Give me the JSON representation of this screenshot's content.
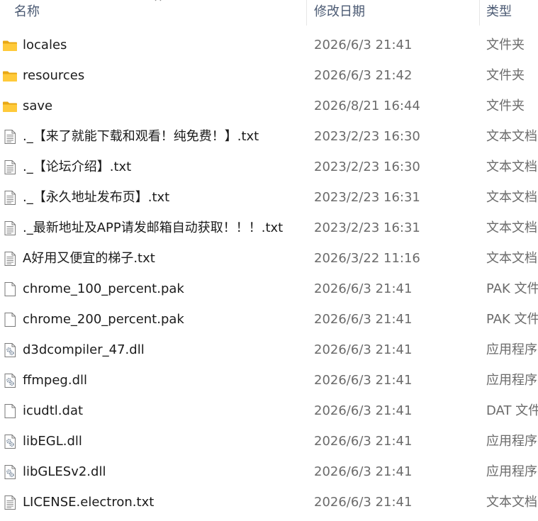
{
  "header": {
    "name": "名称",
    "date": "修改日期",
    "type": "类型"
  },
  "files": [
    {
      "icon": "folder-icon",
      "name": "locales",
      "date": "2026/6/3 21:41",
      "type": "文件夹"
    },
    {
      "icon": "folder-icon",
      "name": "resources",
      "date": "2026/6/3 21:42",
      "type": "文件夹"
    },
    {
      "icon": "folder-icon",
      "name": "save",
      "date": "2026/8/21 16:44",
      "type": "文件夹"
    },
    {
      "icon": "text-file-icon",
      "name": "._【来了就能下载和观看！纯免费！】.txt",
      "date": "2023/2/23 16:30",
      "type": "文本文档"
    },
    {
      "icon": "text-file-icon",
      "name": "._【论坛介绍】.txt",
      "date": "2023/2/23 16:30",
      "type": "文本文档"
    },
    {
      "icon": "text-file-icon",
      "name": "._【永久地址发布页】.txt",
      "date": "2023/2/23 16:31",
      "type": "文本文档"
    },
    {
      "icon": "text-file-icon",
      "name": "._最新地址及APP请发邮箱自动获取！！！.txt",
      "date": "2023/2/23 16:31",
      "type": "文本文档"
    },
    {
      "icon": "text-file-icon",
      "name": "A好用又便宜的梯子.txt",
      "date": "2026/3/22 11:16",
      "type": "文本文档"
    },
    {
      "icon": "blank-file-icon",
      "name": "chrome_100_percent.pak",
      "date": "2026/6/3 21:41",
      "type": "PAK 文件"
    },
    {
      "icon": "blank-file-icon",
      "name": "chrome_200_percent.pak",
      "date": "2026/6/3 21:41",
      "type": "PAK 文件"
    },
    {
      "icon": "dll-file-icon",
      "name": "d3dcompiler_47.dll",
      "date": "2026/6/3 21:41",
      "type": "应用程序扩展"
    },
    {
      "icon": "dll-file-icon",
      "name": "ffmpeg.dll",
      "date": "2026/6/3 21:41",
      "type": "应用程序扩展"
    },
    {
      "icon": "blank-file-icon",
      "name": "icudtl.dat",
      "date": "2026/6/3 21:41",
      "type": "DAT 文件"
    },
    {
      "icon": "dll-file-icon",
      "name": "libEGL.dll",
      "date": "2026/6/3 21:41",
      "type": "应用程序扩展"
    },
    {
      "icon": "dll-file-icon",
      "name": "libGLESv2.dll",
      "date": "2026/6/3 21:41",
      "type": "应用程序扩展"
    },
    {
      "icon": "text-file-icon",
      "name": "LICENSE.electron.txt",
      "date": "2026/6/3 21:41",
      "type": "文本文档"
    }
  ]
}
